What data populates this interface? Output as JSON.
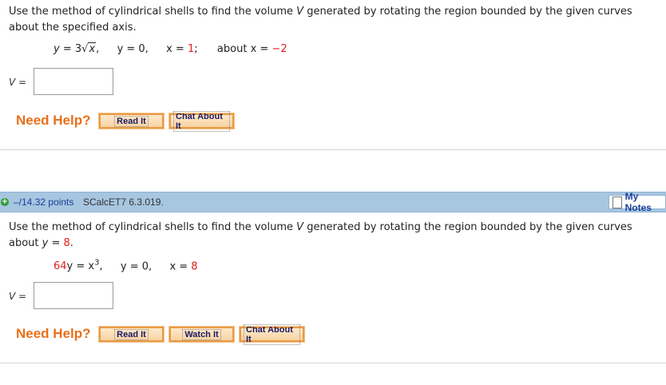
{
  "q1": {
    "prompt_line1_pre": "Use the method of cylindrical shells to find the volume ",
    "prompt_var": "V",
    "prompt_line1_post": " generated by rotating the region bounded by the given curves",
    "prompt_line2": "about the specified axis.",
    "eq_y1_lhs": "y",
    "eq_y1_eq": " = 3",
    "eq_y1_rad": "x",
    "eq_y1_tail": ",",
    "eq_y2": "y = 0,",
    "eq_x_lhs": "x = ",
    "eq_x_val": "1",
    "eq_x_tail": ";",
    "eq_axis_lhs": "about x = ",
    "eq_axis_val": "−2",
    "v_label": "V =",
    "v_value": "",
    "need_help": "Need Help?",
    "btn_read": "Read It",
    "btn_chat": "Chat About It"
  },
  "q2": {
    "plus_icon": "+",
    "points": "–/14.32 points",
    "code": "SCalcET7 6.3.019.",
    "my_notes": "My Notes",
    "prompt_line1_pre": "Use the method of cylindrical shells to find the volume ",
    "prompt_var": "V",
    "prompt_line1_post": " generated by rotating the region bounded by the given curves",
    "prompt_line2_pre": "about ",
    "prompt_line2_var": "y",
    "prompt_line2_eq": " = ",
    "prompt_line2_val": "8",
    "prompt_line2_tail": ".",
    "eq1_coef": "64",
    "eq1_rest": "y = x",
    "eq1_exp": "3",
    "eq1_tail": ",",
    "eq2": "y = 0,",
    "eq3_lhs": "x = ",
    "eq3_val": "8",
    "v_label": "V =",
    "v_value": "",
    "need_help": "Need Help?",
    "btn_read": "Read It",
    "btn_watch": "Watch It",
    "btn_chat": "Chat About It"
  },
  "colors": {
    "accent_red": "#e0201a",
    "help_orange": "#e8701a",
    "bar_blue": "#a7c6e0",
    "link_blue": "#1a3e9a"
  },
  "icons": {
    "plus": "plus-circle-icon",
    "notes": "notes-icon"
  }
}
